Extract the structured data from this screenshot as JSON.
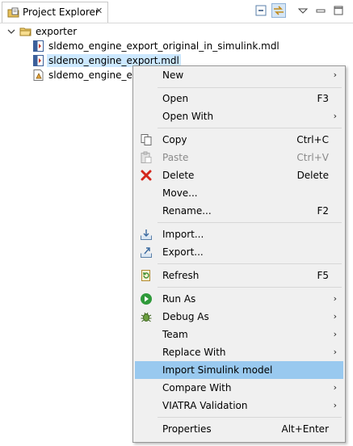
{
  "view": {
    "title": "Project Explorer",
    "close": "✕"
  },
  "tree": {
    "project": "exporter",
    "files": [
      "sldemo_engine_export_original_in_simulink.mdl",
      "sldemo_engine_export.mdl",
      "sldemo_engine_expo"
    ]
  },
  "menu": {
    "arrow": "›",
    "new": "New",
    "open": "Open",
    "open_key": "F3",
    "open_with": "Open With",
    "copy": "Copy",
    "copy_key": "Ctrl+C",
    "paste": "Paste",
    "paste_key": "Ctrl+V",
    "delete": "Delete",
    "delete_key": "Delete",
    "move": "Move...",
    "rename": "Rename...",
    "rename_key": "F2",
    "import": "Import...",
    "export": "Export...",
    "refresh": "Refresh",
    "refresh_key": "F5",
    "run_as": "Run As",
    "debug_as": "Debug As",
    "team": "Team",
    "replace_with": "Replace With",
    "import_simulink": "Import Simulink model",
    "compare_with": "Compare With",
    "viatra": "VIATRA Validation",
    "properties": "Properties",
    "properties_key": "Alt+Enter"
  },
  "colors": {
    "selection": "#cce8ff",
    "menu_highlight": "#99c9ef",
    "menu_bg": "#f0f0f0"
  }
}
